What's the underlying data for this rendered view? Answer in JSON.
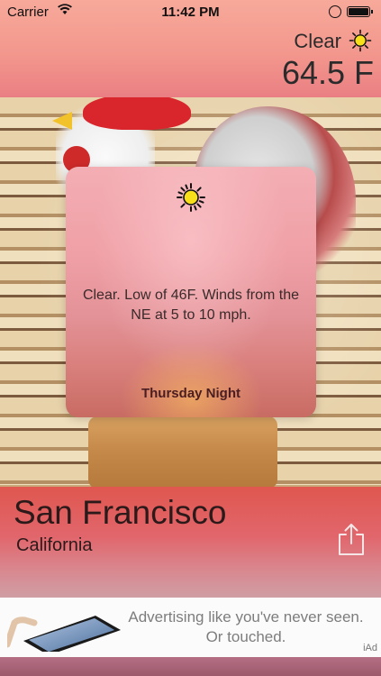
{
  "status_bar": {
    "carrier": "Carrier",
    "time": "11:42 PM"
  },
  "current": {
    "condition": "Clear",
    "condition_icon": "sun-icon",
    "temperature": "64.5 F"
  },
  "forecast_card": {
    "icon": "sun-icon",
    "description": "Clear. Low of 46F. Winds from the NE at 5 to 10 mph.",
    "period": "Thursday Night"
  },
  "location": {
    "city": "San Francisco",
    "state": "California",
    "share_icon": "share-icon"
  },
  "ad": {
    "line1": "Advertising like you've never seen.",
    "line2": "Or touched.",
    "badge": "iAd"
  },
  "colors": {
    "top_band": "#f3978d",
    "location_band": "#e0574f",
    "sun": "#f7e01a",
    "text_dark": "#2b2b2b"
  }
}
